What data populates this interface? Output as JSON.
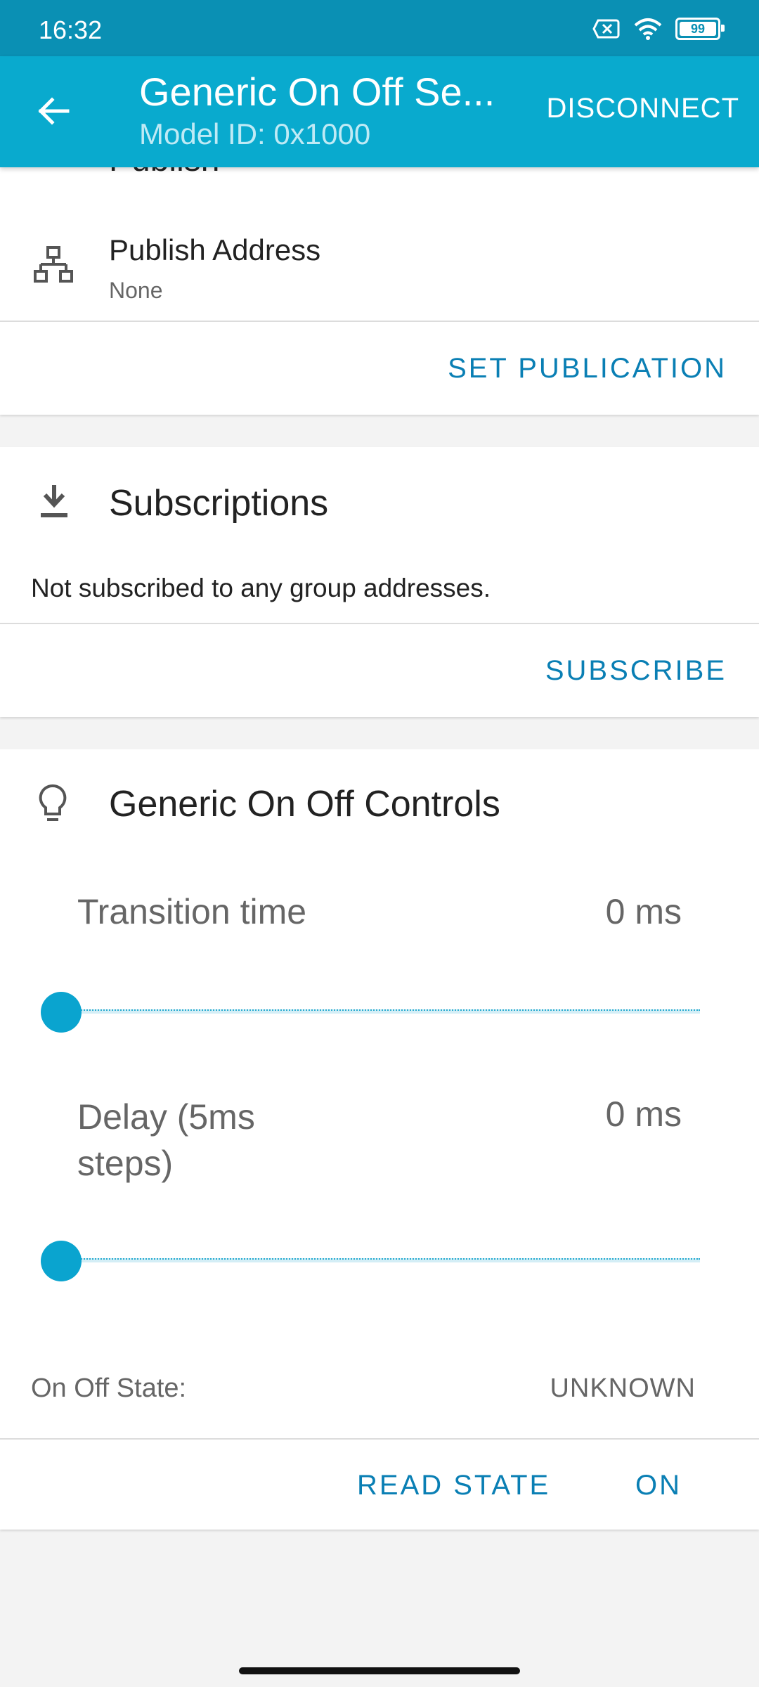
{
  "status_bar": {
    "time": "16:32",
    "battery": "99"
  },
  "app_bar": {
    "title": "Generic On Off Se...",
    "subtitle": "Model ID: 0x1000",
    "disconnect": "DISCONNECT"
  },
  "publish_card": {
    "header_partial": "Publish",
    "address_label": "Publish Address",
    "address_value": "None",
    "action": "SET PUBLICATION"
  },
  "subscriptions_card": {
    "title": "Subscriptions",
    "message": "Not subscribed to any group addresses.",
    "action": "SUBSCRIBE"
  },
  "controls_card": {
    "title": "Generic On Off Controls",
    "transition_label": "Transition time",
    "transition_value": "0 ms",
    "transition_level": 0,
    "delay_label_line1": "Delay (5ms",
    "delay_label_line2": "steps)",
    "delay_value": "0 ms",
    "delay_level": 0,
    "state_label": "On Off State:",
    "state_value": "UNKNOWN",
    "read_state": "READ STATE",
    "on": "ON"
  },
  "colors": {
    "accent": "#09aace",
    "status_bar": "#0a90b4",
    "button_text": "#0a7fb4"
  }
}
